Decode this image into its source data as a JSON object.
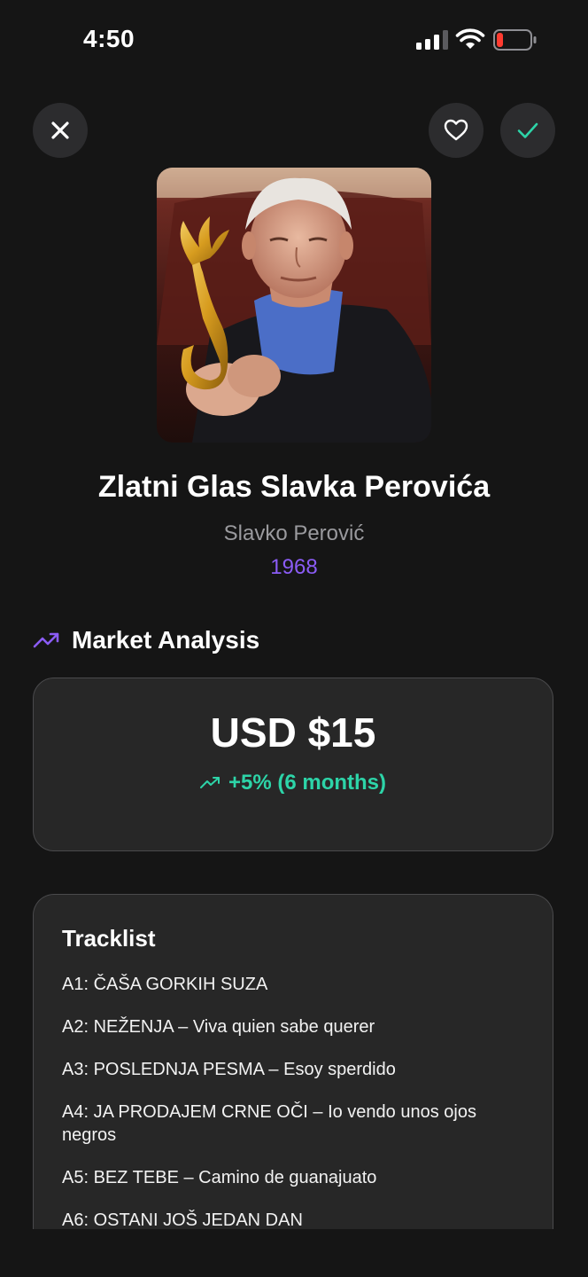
{
  "status_bar": {
    "time": "4:50",
    "signal_icon": "cellular-signal-icon",
    "wifi_icon": "wifi-icon",
    "battery_icon": "battery-low-icon",
    "battery_color": "#ff3b30"
  },
  "header": {
    "close_icon": "close-icon",
    "favorite_icon": "heart-icon",
    "check_icon": "checkmark-icon",
    "check_color": "#2dd4a8"
  },
  "album": {
    "title": "Zlatni Glas Slavka Perovića",
    "artist": "Slavko Perović",
    "year": "1968",
    "year_color": "#8b5cf6"
  },
  "market": {
    "section_title": "Market Analysis",
    "section_icon": "trending-up-icon",
    "price": "USD $15",
    "change": "+5% (6 months)",
    "change_color": "#2dd4a8"
  },
  "tracklist": {
    "title": "Tracklist",
    "tracks": [
      "A1: ČAŠA GORKIH SUZA",
      "A2: NEŽENJA – Viva quien sabe querer",
      "A3: POSLEDNJA PESMA – Esoy sperdido",
      "A4: JA PRODAJEM CRNE OČI – Io vendo unos ojos negros",
      "A5: BEZ TEBE – Camino de guanajuato",
      "A6: OSTANI JOŠ JEDAN DAN"
    ]
  }
}
